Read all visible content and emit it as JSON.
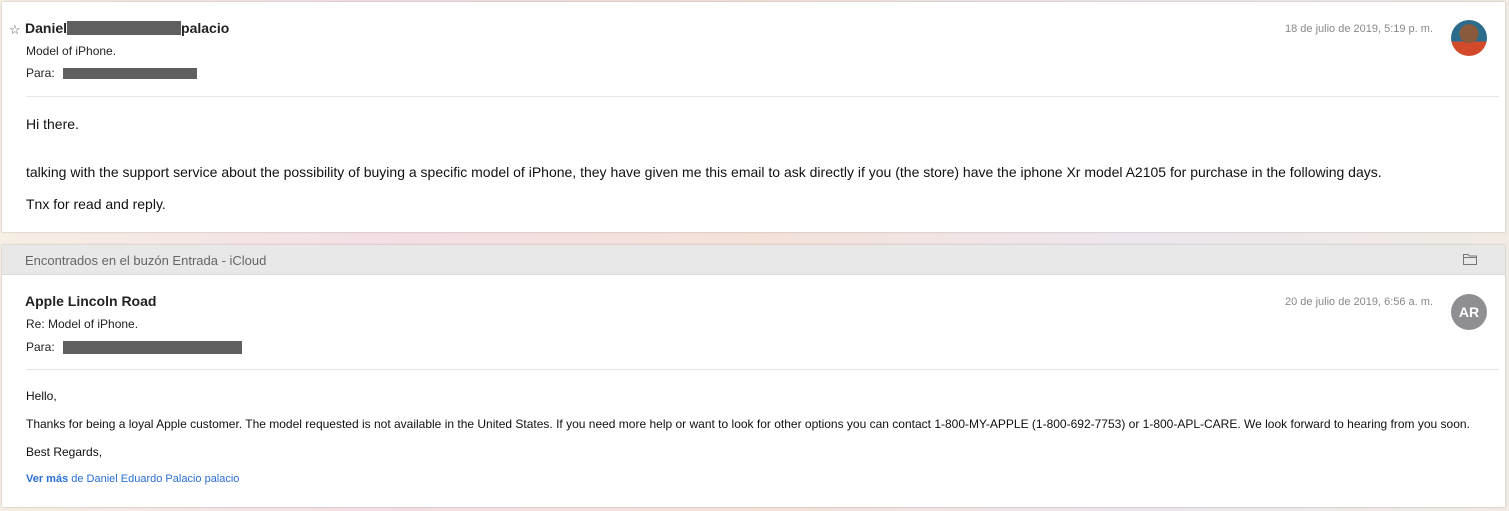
{
  "messages": [
    {
      "sender_first": "Daniel",
      "sender_last": "palacio",
      "subject": "Model of iPhone.",
      "to_label": "Para:",
      "date": "18 de julio de 2019, 5:19 p. m.",
      "starred_icon": "☆",
      "avatar": "photo",
      "body": [
        "Hi there.",
        "talking with the support service about the possibility of buying a specific model of iPhone, they have given me this email to ask directly if you (the store) have the iphone Xr model A2105 for purchase in the following days.",
        "Tnx for read and reply."
      ]
    },
    {
      "mailbox_label": "Encontrados en el buzón Entrada - iCloud",
      "sender": "Apple Lincoln Road",
      "subject": "Re: Model of iPhone.",
      "to_label": "Para:",
      "date": "20 de julio de 2019, 6:56 a. m.",
      "avatar_initials": "AR",
      "body": [
        "Hello,",
        "Thanks for being a loyal Apple customer. The model requested is not available in the United States. If you need more help or want to look for other options you can contact 1-800-MY-APPLE (1-800-692-7753) or 1-800-APL-CARE. We look forward to hearing from you soon.",
        "Best Regards,"
      ],
      "see_more_bold": "Ver más",
      "see_more_rest": " de Daniel Eduardo Palacio palacio"
    }
  ],
  "icons": {
    "star": "star-outline-icon",
    "folder": "folder-icon"
  }
}
